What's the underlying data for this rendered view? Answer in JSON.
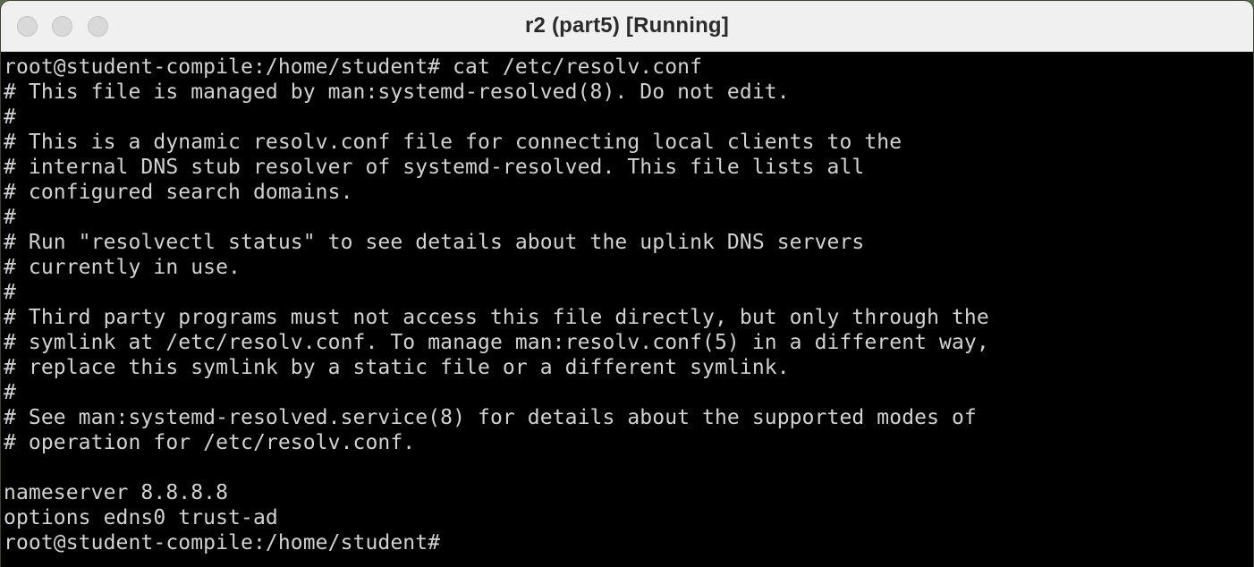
{
  "window": {
    "title": "r2 (part5) [Running]"
  },
  "terminal": {
    "lines": [
      "root@student-compile:/home/student# cat /etc/resolv.conf",
      "# This file is managed by man:systemd-resolved(8). Do not edit.",
      "#",
      "# This is a dynamic resolv.conf file for connecting local clients to the",
      "# internal DNS stub resolver of systemd-resolved. This file lists all",
      "# configured search domains.",
      "#",
      "# Run \"resolvectl status\" to see details about the uplink DNS servers",
      "# currently in use.",
      "#",
      "# Third party programs must not access this file directly, but only through the",
      "# symlink at /etc/resolv.conf. To manage man:resolv.conf(5) in a different way,",
      "# replace this symlink by a static file or a different symlink.",
      "#",
      "# See man:systemd-resolved.service(8) for details about the supported modes of",
      "# operation for /etc/resolv.conf.",
      "",
      "nameserver 8.8.8.8",
      "options edns0 trust-ad",
      "root@student-compile:/home/student#"
    ]
  }
}
